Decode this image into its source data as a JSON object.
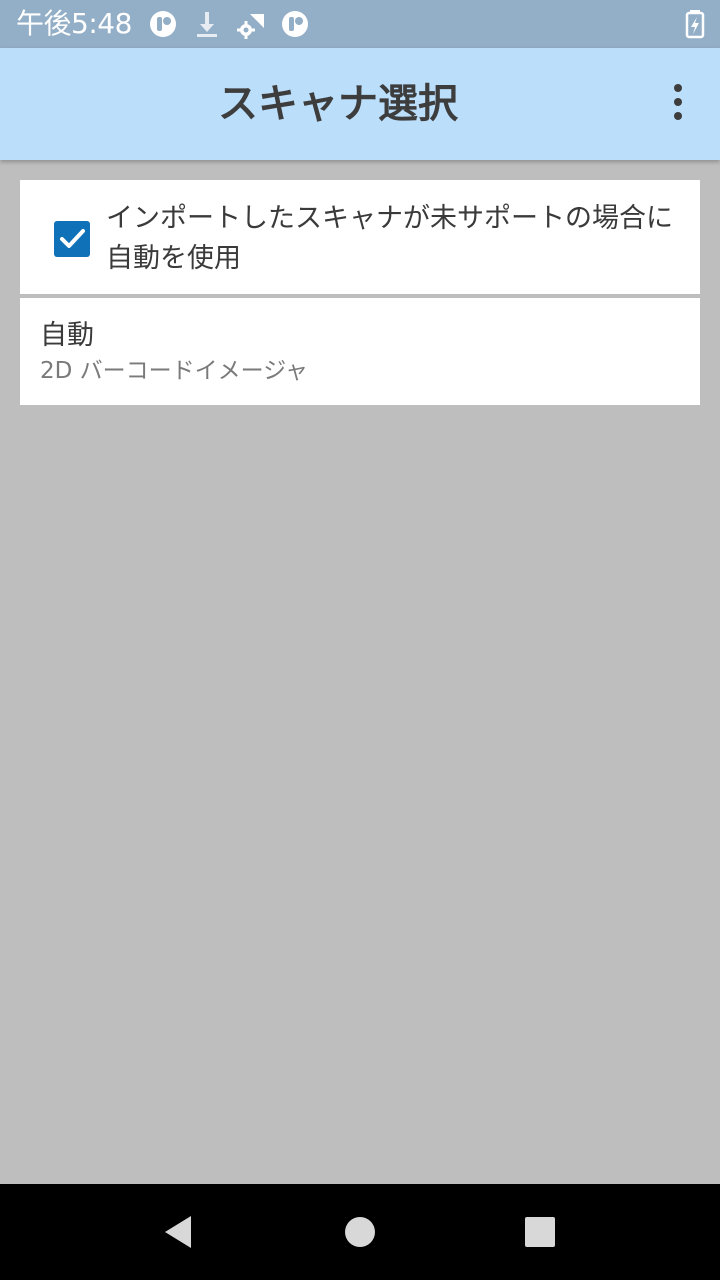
{
  "status_bar": {
    "time": "午後5:48",
    "icons": [
      "notification-app-icon",
      "download-icon",
      "settings-wifi-icon",
      "notification-app-icon",
      "battery-charging-icon"
    ]
  },
  "app_bar": {
    "title": "スキャナ選択",
    "overflow_icon": "more-vert-icon"
  },
  "settings": {
    "auto_checkbox": {
      "checked": true,
      "label": "インポートしたスキャナが未サポートの場合に自動を使用"
    },
    "scanner_item": {
      "name": "自動",
      "type": "2D バーコードイメージャ"
    }
  },
  "nav_bar": {
    "buttons": [
      "back-icon",
      "home-icon",
      "recents-icon"
    ]
  },
  "colors": {
    "status_bar": "#93aec7",
    "app_bar": "#bbdefa",
    "background": "#bebebe",
    "checkbox": "#0f71b8",
    "nav_bar": "#000000"
  }
}
